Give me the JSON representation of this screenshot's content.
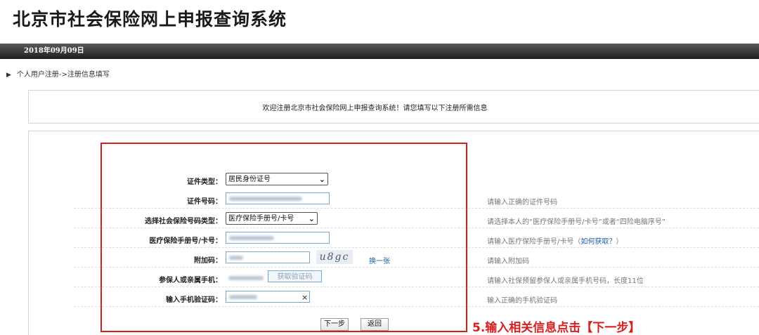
{
  "header": {
    "title": "北京市社会保险网上申报查询系统",
    "date": "2018年09月09日"
  },
  "breadcrumb": {
    "arrow": "▶",
    "text": "个人用户注册->注册信息填写"
  },
  "welcome": "欢迎注册北京市社会保险网上申报查询系统！请您填写以下注册所需信息",
  "form": {
    "id_type": {
      "label": "证件类型：",
      "value": "居民身份证号",
      "chevron": "⌄"
    },
    "id_number": {
      "label": "证件号码：",
      "hint": "请输入正确的证件号码"
    },
    "insurance_type": {
      "label": "选择社会保险号码类型：",
      "value": "医疗保险手册号/卡号",
      "chevron": "⌄",
      "hint": "请选择本人的“医疗保险手册号/卡号”或者“四险电脑序号”"
    },
    "insurance_number": {
      "label": "医疗保险手册号/卡号：",
      "hint": "请输入医疗保险手册号/卡号（",
      "hint_link": "如何获取？",
      "hint_end": "）"
    },
    "captcha": {
      "label": "附加码：",
      "image_text": "u8gc",
      "refresh": "换一张",
      "hint": "请输入附加码"
    },
    "phone": {
      "label": "参保人或亲属手机：",
      "button": "获取验证码",
      "hint": "请输入社保预留参保人或亲属手机号码，长度11位"
    },
    "sms_code": {
      "label": "输入手机验证码：",
      "clear": "×",
      "hint": "输入正确的手机验证码"
    }
  },
  "actions": {
    "next": "下一步",
    "back": "返回"
  },
  "annotation": "5.输入相关信息点击【下一步】",
  "colors": {
    "annotation": "#d71f1f",
    "link": "#1a5fa8",
    "input_border": "#7aa6d6"
  }
}
